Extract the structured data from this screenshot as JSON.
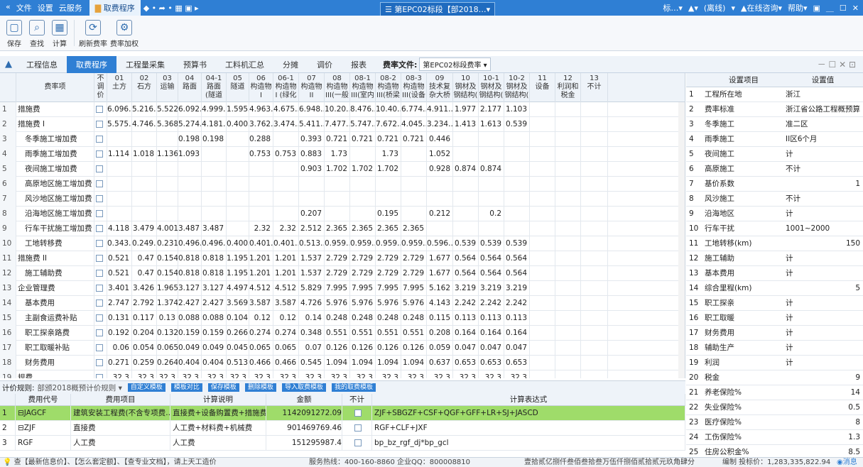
{
  "titlebar": {
    "left_items": [
      "«",
      "文件",
      "设置",
      "云服务"
    ],
    "active_tab": "取费程序",
    "arrows": "◆ • ➦ • ▦ ▣ ▸",
    "center": "☰ 第EPC02标段【部2018…▾",
    "right_items": [
      "标…▾",
      "▲▾",
      "(离线)",
      "▾",
      "▲在线咨询▾",
      "帮助▾",
      "▣",
      "＿",
      "☐",
      "✕"
    ]
  },
  "ribbon": [
    {
      "label": "保存",
      "icon": "▢"
    },
    {
      "label": "查找",
      "icon": "⌕"
    },
    {
      "label": "计算",
      "icon": "▦"
    },
    {
      "label": "刷新费率",
      "icon": "⟳"
    },
    {
      "label": "费率加权",
      "icon": "⚙"
    }
  ],
  "tabs": [
    "工程信息",
    "取费程序",
    "工程量采集",
    "预算书",
    "工料机汇总",
    "分摊",
    "调价",
    "报表"
  ],
  "active_tab": "取费程序",
  "rate": {
    "label": "费率文件:",
    "value": "第EPC02标段费率 ▾"
  },
  "window_controls": "－ ☐ ✕ ⊡",
  "grid": {
    "headers": [
      "",
      "费率项",
      "不调价",
      "01\n土方",
      "02\n石方",
      "03\n运输",
      "04\n路面",
      "04-1\n路面\n(隧道",
      "05\n隧道",
      "06\n构造物\nI",
      "06-1\n构造物\nI (绿化",
      "07\n构造物\nII",
      "08\n构造物\nIII(一般",
      "08-1\n构造物\nIII(室内",
      "08-2\n构造物\nIII(桥梁",
      "08-3\n构造物\nIII(设备",
      "09\n技术复\n杂大桥",
      "10\n钢材及\n钢结构(",
      "10-1\n钢材及\n钢结构(",
      "10-2\n钢材及\n钢结构(",
      "11\n设备",
      "12\n利润和\n税金",
      "13\n不计"
    ],
    "rows": [
      {
        "n": "1",
        "name": "措施费",
        "v": [
          "6.096…",
          "5.216…",
          "5.522",
          "6.092…",
          "4.999…",
          "1.5955",
          "4.963…",
          "4.675…",
          "6.948…",
          "10.20…",
          "8.476…",
          "10.40…",
          "6.774…",
          "4.911…",
          "1.977",
          "2.177",
          "1.103",
          "",
          "",
          ""
        ]
      },
      {
        "n": "2",
        "name": "措施费 I",
        "v": [
          "5.575…",
          "4.746…",
          "5.368",
          "5.274…",
          "4.181…",
          "0.4005",
          "3.762…",
          "3.474…",
          "5.411…",
          "7.477…",
          "5.747…",
          "7.672…",
          "4.045…",
          "3.234…",
          "1.413",
          "1.613",
          "0.539",
          "",
          "",
          ""
        ]
      },
      {
        "n": "3",
        "name": "冬季施工增加费",
        "v": [
          "",
          "",
          "",
          "0.198",
          "0.198",
          "",
          "0.288",
          "",
          "0.393",
          "0.721",
          "0.721",
          "0.721",
          "0.721",
          "0.446",
          "",
          "",
          "",
          "",
          "",
          ""
        ]
      },
      {
        "n": "4",
        "name": "雨季施工增加费",
        "v": [
          "1.114",
          "1.018",
          "1.136",
          "1.093",
          "",
          "",
          "0.753",
          "0.753",
          "0.883",
          "1.73",
          "",
          "1.73",
          "",
          "1.052",
          "",
          "",
          "",
          "",
          "",
          ""
        ]
      },
      {
        "n": "5",
        "name": "夜间施工增加费",
        "v": [
          "",
          "",
          "",
          "",
          "",
          "",
          "",
          "",
          "0.903",
          "1.702",
          "1.702",
          "1.702",
          "",
          "0.928",
          "0.874",
          "0.874",
          "",
          "",
          "",
          ""
        ]
      },
      {
        "n": "6",
        "name": "高原地区施工增加费",
        "v": [
          "",
          "",
          "",
          "",
          "",
          "",
          "",
          "",
          "",
          "",
          "",
          "",
          "",
          "",
          "",
          "",
          "",
          "",
          "",
          ""
        ]
      },
      {
        "n": "7",
        "name": "风沙地区施工增加费",
        "v": [
          "",
          "",
          "",
          "",
          "",
          "",
          "",
          "",
          "",
          "",
          "",
          "",
          "",
          "",
          "",
          "",
          "",
          "",
          "",
          ""
        ]
      },
      {
        "n": "8",
        "name": "沿海地区施工增加费",
        "v": [
          "",
          "",
          "",
          "",
          "",
          "",
          "",
          "",
          "0.207",
          "",
          "",
          "0.195",
          "",
          "0.212",
          "",
          "0.2",
          "",
          "",
          "",
          ""
        ]
      },
      {
        "n": "9",
        "name": "行车干扰施工增加费",
        "v": [
          "4.118",
          "3.479",
          "4.001",
          "3.487",
          "3.487",
          "",
          "2.32",
          "2.32",
          "2.512",
          "2.365",
          "2.365",
          "2.365",
          "2.365",
          "",
          "",
          "",
          "",
          "",
          "",
          ""
        ]
      },
      {
        "n": "10",
        "name": "工地转移费",
        "v": [
          "0.343…",
          "0.249…",
          "0.231",
          "0.496…",
          "0.496…",
          "0.4005",
          "0.401…",
          "0.401…",
          "0.513…",
          "0.959…",
          "0.959…",
          "0.959…",
          "0.959…",
          "0.596…",
          "0.539",
          "0.539",
          "0.539",
          "",
          "",
          ""
        ]
      },
      {
        "n": "11",
        "name": "措施费 II",
        "v": [
          "0.521",
          "0.47",
          "0.154",
          "0.818",
          "0.818",
          "1.195",
          "1.201",
          "1.201",
          "1.537",
          "2.729",
          "2.729",
          "2.729",
          "2.729",
          "1.677",
          "0.564",
          "0.564",
          "0.564",
          "",
          "",
          ""
        ]
      },
      {
        "n": "12",
        "name": "施工辅助费",
        "v": [
          "0.521",
          "0.47",
          "0.154",
          "0.818",
          "0.818",
          "1.195",
          "1.201",
          "1.201",
          "1.537",
          "2.729",
          "2.729",
          "2.729",
          "2.729",
          "1.677",
          "0.564",
          "0.564",
          "0.564",
          "",
          "",
          ""
        ]
      },
      {
        "n": "13",
        "name": "企业管理费",
        "v": [
          "3.401",
          "3.426",
          "1.965",
          "3.127",
          "3.127",
          "4.497",
          "4.512",
          "4.512",
          "5.829",
          "7.995",
          "7.995",
          "7.995",
          "7.995",
          "5.162",
          "3.219",
          "3.219",
          "3.219",
          "",
          "",
          ""
        ]
      },
      {
        "n": "14",
        "name": "基本费用",
        "v": [
          "2.747",
          "2.792",
          "1.374",
          "2.427",
          "2.427",
          "3.569",
          "3.587",
          "3.587",
          "4.726",
          "5.976",
          "5.976",
          "5.976",
          "5.976",
          "4.143",
          "2.242",
          "2.242",
          "2.242",
          "",
          "",
          ""
        ]
      },
      {
        "n": "15",
        "name": "主副食运费补贴",
        "v": [
          "0.131",
          "0.117",
          "0.13",
          "0.088",
          "0.088",
          "0.104",
          "0.12",
          "0.12",
          "0.14",
          "0.248",
          "0.248",
          "0.248",
          "0.248",
          "0.115",
          "0.113",
          "0.113",
          "0.113",
          "",
          "",
          ""
        ]
      },
      {
        "n": "16",
        "name": "职工探亲路费",
        "v": [
          "0.192",
          "0.204",
          "0.132",
          "0.159",
          "0.159",
          "0.266",
          "0.274",
          "0.274",
          "0.348",
          "0.551",
          "0.551",
          "0.551",
          "0.551",
          "0.208",
          "0.164",
          "0.164",
          "0.164",
          "",
          "",
          ""
        ]
      },
      {
        "n": "17",
        "name": "职工取暖补贴",
        "v": [
          "0.06",
          "0.054",
          "0.065",
          "0.049",
          "0.049",
          "0.045",
          "0.065",
          "0.065",
          "0.07",
          "0.126",
          "0.126",
          "0.126",
          "0.126",
          "0.059",
          "0.047",
          "0.047",
          "0.047",
          "",
          "",
          ""
        ]
      },
      {
        "n": "18",
        "name": "财务费用",
        "v": [
          "0.271",
          "0.259",
          "0.264",
          "0.404",
          "0.404",
          "0.513",
          "0.466",
          "0.466",
          "0.545",
          "1.094",
          "1.094",
          "1.094",
          "1.094",
          "0.637",
          "0.653",
          "0.653",
          "0.653",
          "",
          "",
          ""
        ]
      },
      {
        "n": "19",
        "name": "规费",
        "v": [
          "32.3",
          "32.3",
          "32.3",
          "32.3",
          "32.3",
          "32.3",
          "32.3",
          "32.3",
          "32.3",
          "32.3",
          "32.3",
          "32.3",
          "32.3",
          "32.3",
          "32.3",
          "32.3",
          "32.3",
          "",
          "",
          ""
        ]
      }
    ]
  },
  "settings": {
    "headers": [
      "设置项目",
      "设置值"
    ],
    "rows": [
      [
        "1",
        "工程所在地",
        "浙江"
      ],
      [
        "2",
        "费率标准",
        "浙江省公路工程概预算…"
      ],
      [
        "3",
        "冬季施工",
        "准二区"
      ],
      [
        "4",
        "雨季施工",
        "II区6个月"
      ],
      [
        "5",
        "夜间施工",
        "计"
      ],
      [
        "6",
        "高原施工",
        "不计"
      ],
      [
        "7",
        "基价系数",
        "1"
      ],
      [
        "8",
        "风沙施工",
        "不计"
      ],
      [
        "9",
        "沿海地区",
        "计"
      ],
      [
        "10",
        "行车干扰",
        "1001~2000"
      ],
      [
        "11",
        "工地转移(km)",
        "150"
      ],
      [
        "12",
        "施工辅助",
        "计"
      ],
      [
        "13",
        "基本费用",
        "计"
      ],
      [
        "14",
        "综合里程(km)",
        "5"
      ],
      [
        "15",
        "职工探亲",
        "计"
      ],
      [
        "16",
        "职工取暖",
        "计"
      ],
      [
        "17",
        "财务费用",
        "计"
      ],
      [
        "18",
        "辅助生产",
        "计"
      ],
      [
        "19",
        "利润",
        "计"
      ],
      [
        "20",
        "税金",
        "9"
      ],
      [
        "21",
        "养老保险%",
        "14"
      ],
      [
        "22",
        "失业保险%",
        "0.5"
      ],
      [
        "23",
        "医疗保险%",
        "8"
      ],
      [
        "24",
        "工伤保险%",
        "1.3"
      ],
      [
        "25",
        "住房公积金%",
        "8.5"
      ]
    ]
  },
  "calc": {
    "label": "计价规则:",
    "rule": "部颁2018概预计价规则 ▾",
    "buttons": [
      "自定义模板",
      "模板对比",
      "保存模板",
      "删除模板",
      "导入取费模板",
      "我的取费模板"
    ],
    "headers": [
      "",
      "费用代号",
      "费用项目",
      "计算说明",
      "金额",
      "不计",
      "计算表达式"
    ],
    "rows": [
      [
        "1",
        "⊟JAGCF",
        "建筑安装工程费(不含专项费…",
        "直接费+设备购置费+措施费+企业管理…",
        "1142091272.09",
        "ZJF+SBGZF+CSF+QGF+GFF+LR+SJ+JASCD"
      ],
      [
        "2",
        "⊟ZJF",
        "直接费",
        "人工费+材料费+机械费",
        "901469769.46",
        "RGF+CLF+JXF"
      ],
      [
        "3",
        "RGF",
        "人工费",
        "人工费",
        "151295987.4",
        "bp_bz_rgf_dj*bp_gcl"
      ]
    ]
  },
  "status": {
    "left": "💡 查【最新信息价】、【怎么套定额】、【查专业文档】，请上天工造价",
    "center": "服务热线：400-160-8860  企业QQ：800008810",
    "right": "壹拾贰亿捌仟叁佰叁拾叁万伍仟捌佰贰拾贰元玖角肆分",
    "edit": "编制 投标价：1,283,335,822.94",
    "msg": "◉消息"
  }
}
